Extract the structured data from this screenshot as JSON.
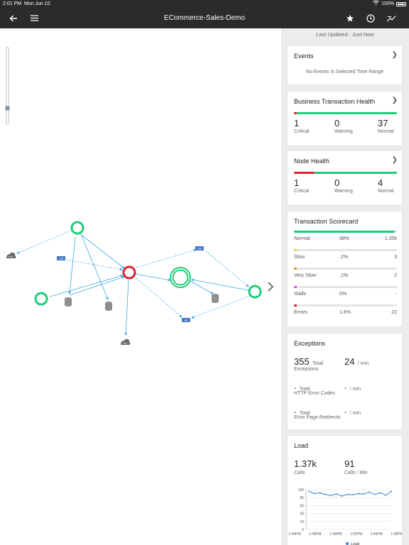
{
  "status_bar": {
    "time": "2:01 PM",
    "date": "Mon Jun 10",
    "battery": "100%"
  },
  "app_bar": {
    "title": "ECommerce-Sales-Demo"
  },
  "icons": {
    "back": "back-arrow-icon",
    "menu": "hamburger-menu-icon",
    "star": "star-icon",
    "clock": "clock-icon",
    "trend": "trend-icon",
    "expand": "chevron-right-icon",
    "db": "database-icon",
    "cloud": "cloud-icon",
    "queue": "queue-icon"
  },
  "colors": {
    "critical": "#e02030",
    "normal": "#1fcc7a",
    "slow": "#f5d327",
    "very_slow": "#f08a24",
    "stalls": "#e846e8",
    "errors": "#e02030",
    "edge": "#3aa6e0"
  },
  "map": {
    "node_labels": {
      "cloud": "HTTP",
      "queue": "JMS"
    }
  },
  "side": {
    "last_updated": "Last Updated :  Just Now",
    "events": {
      "title": "Events",
      "empty": "No Events In Selected Time Range"
    },
    "bt_health": {
      "title": "Business Transaction Health",
      "critical": {
        "count": "1",
        "label": "Critical"
      },
      "warning": {
        "count": "0",
        "label": "Warning"
      },
      "normal": {
        "count": "37",
        "label": "Normal"
      },
      "critical_fraction": 0.03
    },
    "node_health": {
      "title": "Node Health",
      "critical": {
        "count": "1",
        "label": "Critical"
      },
      "warning": {
        "count": "0",
        "label": "Warning"
      },
      "normal": {
        "count": "4",
        "label": "Normal"
      },
      "critical_fraction": 0.2
    },
    "scorecard": {
      "title": "Transaction Scorecard",
      "rows": [
        {
          "label": "Normal",
          "pct": "98%",
          "count": "1.35k",
          "fraction": 0.98,
          "color": "#1fcc7a"
        },
        {
          "label": "Slow",
          "pct": ".2%",
          "count": "3",
          "fraction": 0.03,
          "color": "#f5d327"
        },
        {
          "label": "Very Slow",
          "pct": ".1%",
          "count": "2",
          "fraction": 0.03,
          "color": "#f08a24"
        },
        {
          "label": "Stalls",
          "pct": "0%",
          "count": "-",
          "fraction": 0.03,
          "color": "#e846e8"
        },
        {
          "label": "Errors",
          "pct": "1.6%",
          "count": "22",
          "fraction": 0.03,
          "color": "#e02030"
        }
      ]
    },
    "exceptions": {
      "title": "Exceptions",
      "total": {
        "value": "355",
        "unit": "Total",
        "label": "Exceptions",
        "rate": "24",
        "rate_unit": "/ min"
      },
      "http": {
        "value": "-",
        "unit": "Total",
        "label": "HTTP Error Codes",
        "rate": "-",
        "rate_unit": "/ min"
      },
      "redirects": {
        "value": "-",
        "unit": "Total",
        "label": "Error Page Redirects",
        "rate": "-",
        "rate_unit": "/ min"
      }
    },
    "load": {
      "title": "Load",
      "calls": "1.37k",
      "calls_label": "Calls",
      "cpm": "91",
      "cpm_label": "Calls / Min"
    }
  },
  "chart_data": {
    "type": "line",
    "x": [
      "1:44PM",
      "1:46PM",
      "1:49PM",
      "1:52PM",
      "1:55PM",
      "1:58PM"
    ],
    "y_ticks": [
      0,
      20,
      40,
      60,
      80,
      100
    ],
    "ylim": [
      0,
      100
    ],
    "grid": true,
    "legend_position": "bottom",
    "series": [
      {
        "name": "Load",
        "color": "#3a7fd8",
        "values": [
          96,
          90,
          92,
          88,
          85,
          89,
          84,
          88,
          87,
          90,
          89,
          94,
          88,
          92,
          86,
          96
        ]
      }
    ]
  }
}
